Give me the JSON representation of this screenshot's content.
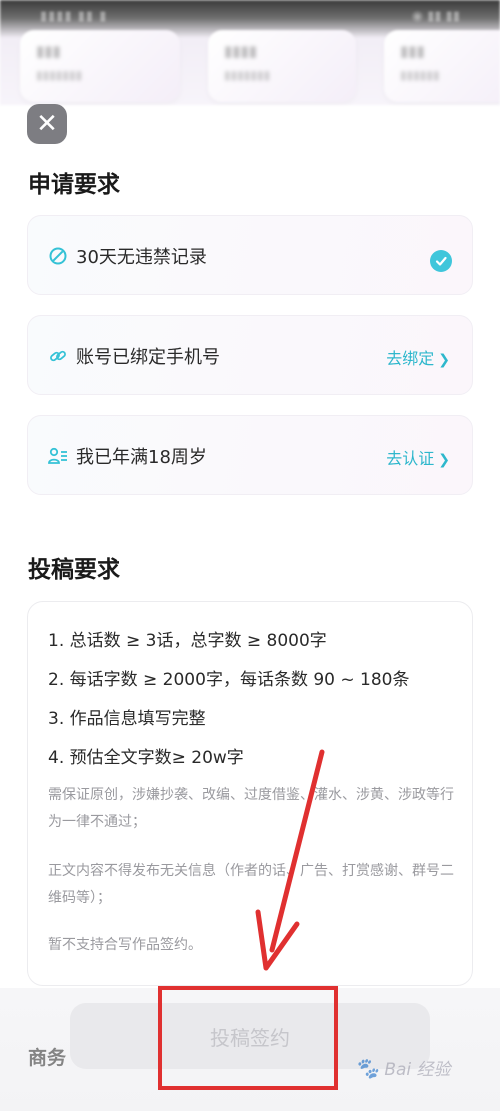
{
  "sections": {
    "apply_title": "申请要求",
    "submit_title": "投稿要求",
    "business_title": "商务"
  },
  "requirements": [
    {
      "label": "30天无违禁记录",
      "status": "done"
    },
    {
      "label": "账号已绑定手机号",
      "action": "去绑定"
    },
    {
      "label": "我已年满18周岁",
      "action": "去认证"
    }
  ],
  "submit_rules": [
    "1. 总话数 ≥ 3话，总字数 ≥ 8000字",
    "2. 每话字数 ≥ 2000字，每话条数 90 ~ 180条",
    "3. 作品信息填写完整",
    "4. 预估全文字数≥ 20w字"
  ],
  "submit_notes": [
    "需保证原创，涉嫌抄袭、改编、过度借鉴、灌水、涉黄、涉政等行为一律不通过；",
    "正文内容不得发布无关信息（作者的话、广告、打赏感谢、群号二维码等）；",
    "暂不支持合写作品签约。"
  ],
  "buttons": {
    "close": "✕",
    "sign": "投稿签约"
  },
  "watermark": "Bai 经验",
  "colors": {
    "accent": "#35c2d6",
    "annotation": "#e03030",
    "button_bg": "#e9e9ec"
  }
}
